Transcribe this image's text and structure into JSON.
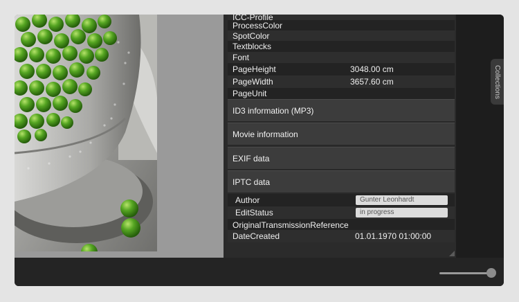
{
  "metadata_rows_top": [
    {
      "key": "ICC-Profile",
      "value": ""
    },
    {
      "key": "ProcessColor",
      "value": ""
    },
    {
      "key": "SpotColor",
      "value": ""
    },
    {
      "key": "Textblocks",
      "value": ""
    },
    {
      "key": "Font",
      "value": ""
    },
    {
      "key": "PageHeight",
      "value": "3048.00 cm"
    },
    {
      "key": "PageWidth",
      "value": "3657.60 cm"
    },
    {
      "key": "PageUnit",
      "value": ""
    }
  ],
  "sections": [
    {
      "label": "ID3 information (MP3)"
    },
    {
      "label": "Movie information"
    },
    {
      "label": "EXIF data"
    },
    {
      "label": "IPTC data"
    }
  ],
  "iptc": {
    "author_label": "Author",
    "author_value": "Gunter Leonhardt",
    "editstatus_label": "EditStatus",
    "editstatus_value": "in progress",
    "otr_label": "OriginalTransmissionReference",
    "datecreated_label": "DateCreated",
    "datecreated_value": "01.01.1970 01:00:00"
  },
  "collections_tab": "Collections",
  "zoom_slider_level": 0.9,
  "colors": {
    "pea_green": "#4c9a1e",
    "panel_bg": "#2b2b2b",
    "section_bg": "#3c3c3c"
  }
}
